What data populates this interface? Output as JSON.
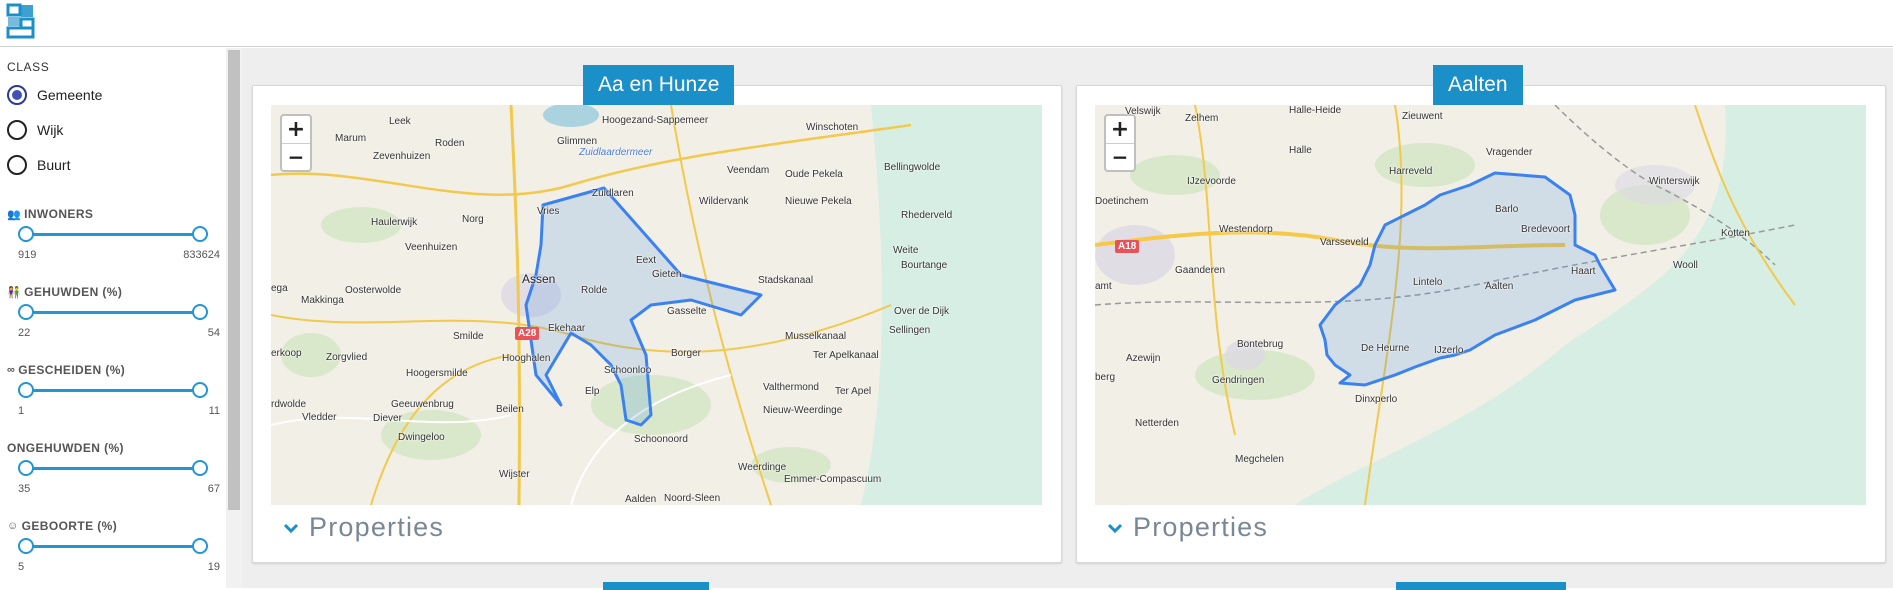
{
  "header": {
    "logo_icon": "cbs-logo-icon",
    "brand_color": "#1a8fc8"
  },
  "sidebar": {
    "class_title": "CLASS",
    "class_options": [
      {
        "label": "Gemeente",
        "checked": true
      },
      {
        "label": "Wijk",
        "checked": false
      },
      {
        "label": "Buurt",
        "checked": false
      }
    ],
    "filters": [
      {
        "title": "INWONERS",
        "icon": "people-icon",
        "min": "919",
        "max": "833624"
      },
      {
        "title": "GEHUWDEN (%)",
        "icon": "couple-icon",
        "min": "22",
        "max": "54"
      },
      {
        "title": "GESCHEIDEN (%)",
        "icon": "rings-icon",
        "min": "1",
        "max": "11"
      },
      {
        "title": "ONGEHUWDEN (%)",
        "icon": "",
        "min": "35",
        "max": "67"
      },
      {
        "title": "GEBOORTE (%)",
        "icon": "baby-icon",
        "min": "5",
        "max": "19"
      }
    ]
  },
  "cards": [
    {
      "title": "Aa en Hunze",
      "properties_label": "Properties",
      "zoom_in": "+",
      "zoom_out": "−",
      "places": [
        "Marum",
        "Leek",
        "Roden",
        "Glimmen",
        "Hoogezand-Sappemeer",
        "Zuidlaardermeer",
        "Winschoten",
        "Zevenhuizen",
        "Veendam",
        "Oude Pekela",
        "Bellingwolde",
        "Zuidlaren",
        "Wildervank",
        "Nieuwe Pekela",
        "Haulerwijk",
        "Norg",
        "Vries",
        "Rhederveld",
        "Veenhuizen",
        "Eext",
        "Weite",
        "Gieten",
        "Bourtange",
        "Assen",
        "Stadskanaal",
        "Oosterwolde",
        "Rolde",
        "Makkinga",
        "Gasselte",
        "Over de Dijk",
        "Ekehaar",
        "Smilde",
        "Musselkanaal",
        "Sellingen",
        "Zorgvlied",
        "Hooghalen",
        "Borger",
        "Ter Apelkanaal",
        "Hoogersmilde",
        "Schoonloo",
        "Valthermond",
        "Elp",
        "Ter Apel",
        "Geeuwenbrug",
        "Beilen",
        "Nieuw-Weerdinge",
        "Diever",
        "Vledder",
        "Schoonoord",
        "Dwingeloo",
        "Weerdinge",
        "Wijster",
        "Emmer-Compascuum",
        "Aalden",
        "Noord-Sleen",
        "ega",
        "erkoop",
        "rdwolde"
      ],
      "road": "A28"
    },
    {
      "title": "Aalten",
      "properties_label": "Properties",
      "zoom_in": "+",
      "zoom_out": "−",
      "places": [
        "Velswijk",
        "Zelhem",
        "Halle-Heide",
        "Zieuwent",
        "Halle",
        "Vragender",
        "Harreveld",
        "IJzevoorde",
        "Winterswijk",
        "Doetinchem",
        "Barlo",
        "Westendorp",
        "Bredevoort",
        "Kotten",
        "Varsseveld",
        "Wooll",
        "Gaanderen",
        "Lintelo",
        "Aalten",
        "Haart",
        "amt",
        "De Heurne",
        "Bontebrug",
        "IJzerlo",
        "Azewijn",
        "Gendringen",
        "berg",
        "Dinxperlo",
        "Netterden",
        "Megchelen"
      ],
      "road": "A18"
    }
  ]
}
